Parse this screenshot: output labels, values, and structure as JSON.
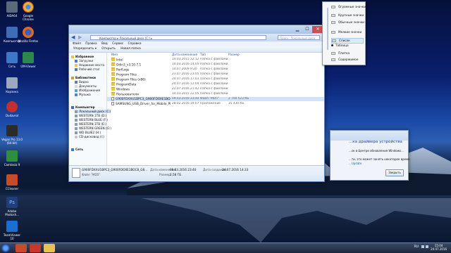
{
  "desktop": {
    "icons": [
      {
        "label": "AIDA64",
        "color": "#5b6a7a"
      },
      {
        "label": "Google Chrome",
        "color": "#e8b22e"
      },
      {
        "label": "Компьютер",
        "color": "#3d6db8"
      },
      {
        "label": "Mozilla Firefox",
        "color": "#e06a1c"
      },
      {
        "label": "Сеть",
        "color": "#3b78c8"
      },
      {
        "label": "UM-Viewer",
        "color": "#2a8a4e"
      },
      {
        "label": "Корзина",
        "color": "#9aa9bf"
      },
      {
        "label": "Dudavrol",
        "color": "#c03030"
      },
      {
        "label": "Vegas Pro 13.0 (64-bit)",
        "color": "#2b2b2b"
      },
      {
        "label": "Camtasia 9",
        "color": "#2d8f3b"
      },
      {
        "label": "CCleaner",
        "color": "#c84a2a"
      },
      {
        "label": "Adobe Photosh...",
        "color": "#1e3f7a"
      },
      {
        "label": "TeamViewer 10",
        "color": "#1b6fd0"
      }
    ]
  },
  "explorer": {
    "address": "Компьютер ▸ Локальный диск (C:) ▸",
    "search_placeholder": "Поиск: Локальный диск (C:)",
    "menu": [
      "Файл",
      "Правка",
      "Вид",
      "Сервис",
      "Справка"
    ],
    "toolbar": [
      "Упорядочить ▾",
      "Открыть",
      "Новая папка"
    ],
    "nav": {
      "favorites": "Избранное",
      "fav_items": [
        "Загрузки",
        "Недавние места",
        "Рабочий стол"
      ],
      "libraries": "Библиотеки",
      "lib_items": [
        "Видео",
        "Документы",
        "Изображения",
        "Музыка"
      ],
      "computer": "Компьютер",
      "drives": [
        "Локальный диск (C:)",
        "WESTERN 1TB (D:)",
        "WESTERN BLUE (F:)",
        "WESTERN 1TB (E:)",
        "WESTERN GREEN (G:)",
        "WD BLUE2 (H:)",
        "CD-дисковод (I:)"
      ],
      "network": "Сеть"
    },
    "columns": [
      "Имя",
      "Дата изменения",
      "Тип",
      "Размер"
    ],
    "rows": [
      {
        "name": "Intel",
        "date": "14.03.2015 22:12",
        "type": "Папка с файлами",
        "size": "",
        "kind": "folder"
      },
      {
        "name": "Odin3_v3.10.7.1",
        "date": "14.03.2016 14:05",
        "type": "Папка с файлами",
        "size": "",
        "kind": "folder"
      },
      {
        "name": "PerfLogs",
        "date": "14.07.2009 9:20",
        "type": "Папка с файлами",
        "size": "",
        "kind": "folder"
      },
      {
        "name": "Program Files",
        "date": "23.07.2016 23:05",
        "type": "Папка с файлами",
        "size": "",
        "kind": "folder"
      },
      {
        "name": "Program Files (x86)",
        "date": "24.07.2016 17:03",
        "type": "Папка с файлами",
        "size": "",
        "kind": "folder"
      },
      {
        "name": "ProgramData",
        "date": "24.07.2016 12:04",
        "type": "Папка с файлами",
        "size": "",
        "kind": "folder"
      },
      {
        "name": "Windows",
        "date": "22.07.2016 21:42",
        "type": "Папка с файлами",
        "size": "",
        "kind": "folder"
      },
      {
        "name": "Пользователи",
        "date": "14.03.2015 22:05",
        "type": "Папка с файлами",
        "size": "",
        "kind": "folder"
      },
      {
        "name": "G900FDXXU1BPC3_G900FDOXE1BOC8_G...",
        "date": "09.03.2016 23:40",
        "type": "Файл \"MD5\"",
        "size": "2 700 523 КБ",
        "kind": "file",
        "selected": true
      },
      {
        "name": "SAMSUNG_USB_Driver_for_Mobile_Phon...",
        "date": "28.02.2016 19:07",
        "type": "Приложение",
        "size": "35 430 КБ",
        "kind": "file"
      }
    ],
    "details": {
      "name": "G900FDXXU1BPC3_G900FDOXE1BOC8_G8...",
      "type": "Файл \"MD5\"",
      "modified_label": "Дата изменения:",
      "modified": "09.03.2016 23:40",
      "size_label": "Размер:",
      "size": "2,58 ГБ",
      "created_label": "Дата создания:",
      "created": "24.07.2016 14:33"
    }
  },
  "view_menu": {
    "items": [
      "Огромные значки",
      "Крупные значки",
      "Обычные значки",
      "Мелкие значки",
      "Список",
      "Таблица",
      "Плитка",
      "Содержимое"
    ],
    "selected": "Таблица",
    "hovered": "Список"
  },
  "driver_notice": {
    "title": "...ка драйвера устройства",
    "line1": "...ск в Центре обновления Windows...",
    "line2": "...ти, это может занять некоторое время.",
    "link": "...Update",
    "close_label": "Закрыть"
  },
  "taskbar": {
    "lang": "RU",
    "time": "15:04",
    "date": "24.07.2016"
  }
}
